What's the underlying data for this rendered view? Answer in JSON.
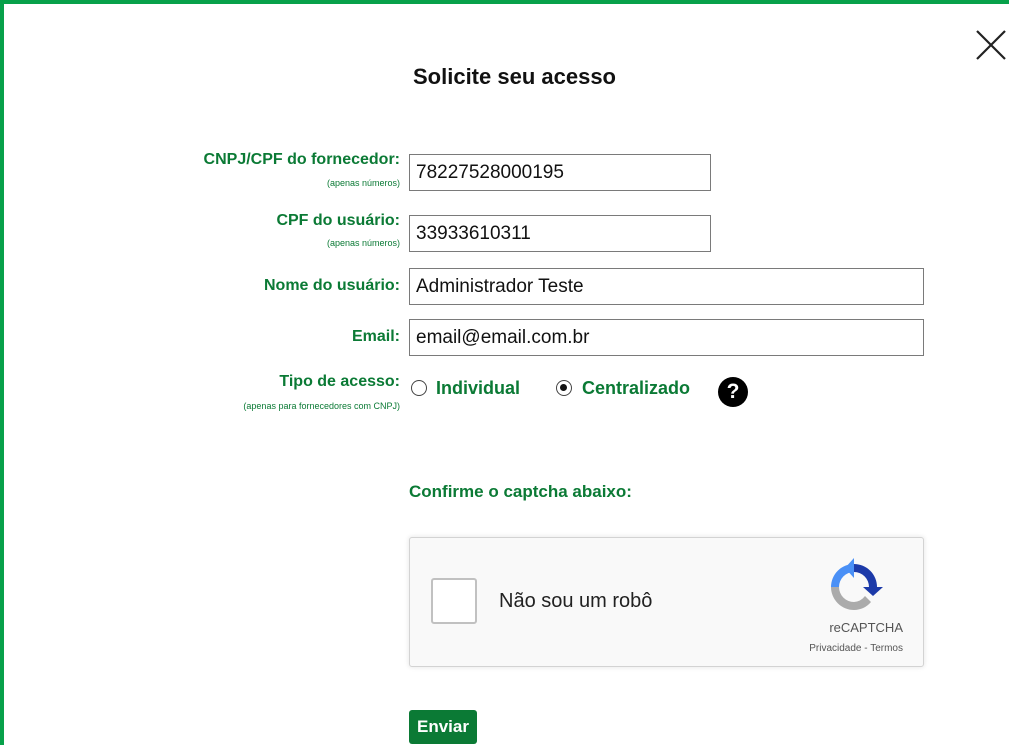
{
  "dialog": {
    "title": "Solicite seu acesso",
    "close_icon": "close-icon"
  },
  "form": {
    "cnpj": {
      "label": "CNPJ/CPF do fornecedor:",
      "hint": "(apenas números)",
      "value": "78227528000195"
    },
    "cpf": {
      "label": "CPF do usuário:",
      "hint": "(apenas números)",
      "value": "33933610311"
    },
    "name": {
      "label": "Nome do usuário:",
      "value": "Administrador Teste"
    },
    "email": {
      "label": "Email:",
      "value": "email@email.com.br"
    },
    "access_type": {
      "label": "Tipo de acesso:",
      "hint": "(apenas para fornecedores com CNPJ)",
      "options": [
        {
          "label": "Individual",
          "selected": false
        },
        {
          "label": "Centralizado",
          "selected": true
        }
      ],
      "help_icon": "question-icon",
      "help_glyph": "?"
    }
  },
  "captcha": {
    "title": "Confirme o captcha abaixo:",
    "checkbox_label": "Não sou um robô",
    "checked": false,
    "brand": "reCAPTCHA",
    "privacy_link": "Privacidade",
    "separator": " - ",
    "terms_link": "Termos"
  },
  "submit_label": "Enviar",
  "colors": {
    "accent": "#07a14a",
    "label_green": "#0b7a35",
    "button_green": "#0b7a35"
  }
}
